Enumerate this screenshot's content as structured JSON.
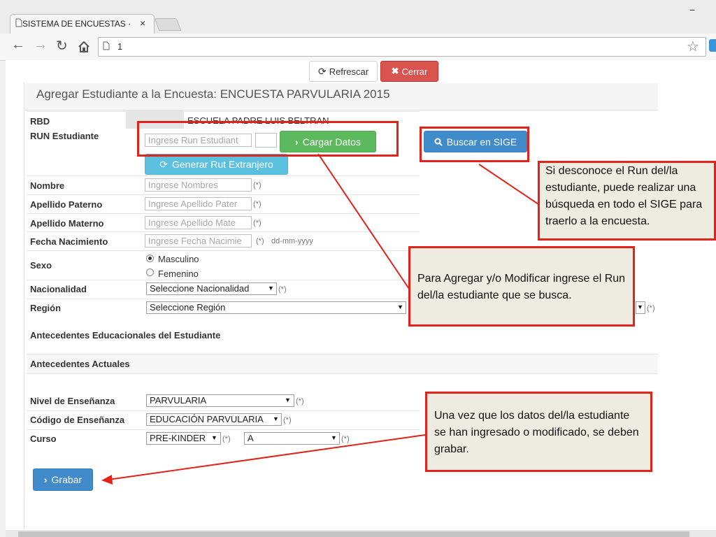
{
  "browser": {
    "tab_title": "SISTEMA DE ENCUESTAS ·",
    "tab_close": "×",
    "url": "1",
    "minimize": "−"
  },
  "toolbar": {
    "refresh_label": "Refrescar",
    "close_label": "Cerrar"
  },
  "form": {
    "title": "Agregar Estudiante a la Encuesta: ENCUESTA PARVULARIA 2015",
    "rbd_label": "RBD",
    "school_name": "ESCUELA PADRE LUIS BELTRAN",
    "run_label": "RUN Estudiante",
    "run_placeholder": "Ingrese Run Estudiant",
    "load_button": "Cargar Datos",
    "sige_button": "Buscar en SIGE",
    "foreign_rut_button": "Generar Rut Extranjero",
    "name_label": "Nombre",
    "name_placeholder": "Ingrese Nombres",
    "paternal_label": "Apellido Paterno",
    "paternal_placeholder": "Ingrese Apellido Pater",
    "maternal_label": "Apellido Materno",
    "maternal_placeholder": "Ingrese Apellido Mate",
    "birth_label": "Fecha Nacimiento",
    "birth_placeholder": "Ingrese Fecha Nacimie",
    "date_format": "dd-mm-yyyy",
    "sex_label": "Sexo",
    "sex_male": "Masculino",
    "sex_female": "Femenino",
    "nationality_label": "Nacionalidad",
    "nationality_value": "Seleccione Nacionalidad",
    "region_label": "Región",
    "region_value": "Seleccione Región",
    "required_mark": "(*)",
    "education_section": "Antecedentes Educacionales del Estudiante",
    "current_section": "Antecedentes Actuales",
    "level_label": "Nivel de Enseñanza",
    "level_value": "PARVULARIA",
    "code_label": "Código de Enseñanza",
    "code_value": "EDUCACIÓN PARVULARIA",
    "course_label": "Curso",
    "course_value": "PRE-KINDER",
    "letter_value": "A",
    "save_button": "Grabar"
  },
  "callouts": {
    "sige": "Si desconoce el Run del/la estudiante, puede realizar una búsqueda en todo el SIGE para traerlo a la encuesta.",
    "run": "Para Agregar y/o Modificar ingrese el Run del/la  estudiante que se busca.",
    "save": "Una vez que los datos del/la estudiante se han ingresado o modificado, se deben grabar."
  },
  "colors": {
    "annotation_red": "#e2231a",
    "callout_bg": "#eeece1",
    "success_green": "#5cb85c",
    "primary_blue": "#428bca",
    "danger_red": "#d9534f"
  }
}
